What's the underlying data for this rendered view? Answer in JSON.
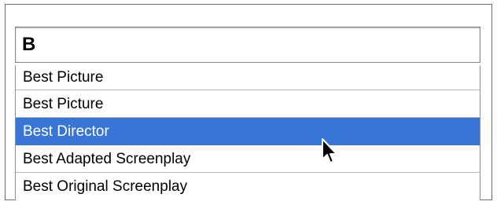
{
  "search": {
    "value": "B"
  },
  "suggestions": [
    {
      "label": "Best Picture"
    },
    {
      "label": "Best Picture"
    },
    {
      "label": "Best Director",
      "highlighted": true
    },
    {
      "label": "Best Adapted Screenplay"
    },
    {
      "label": "Best Original Screenplay"
    }
  ],
  "colors": {
    "highlight": "#3875d7",
    "highlight_text": "#ffffff",
    "row_divider": "#b8b8b8"
  },
  "icons": {
    "cursor": "mouse-pointer-icon"
  }
}
